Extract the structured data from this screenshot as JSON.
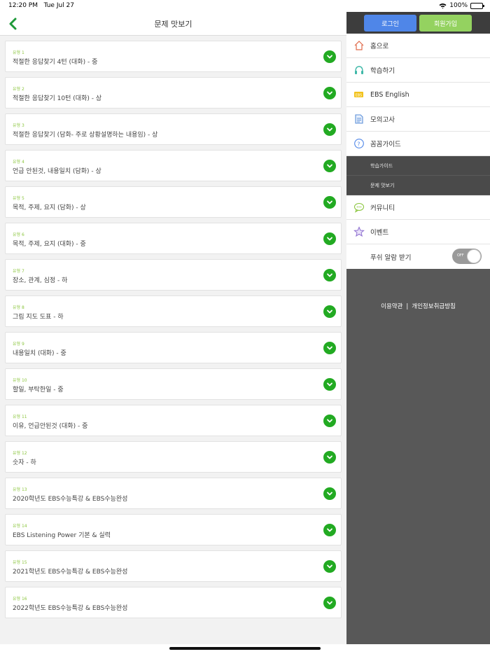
{
  "status_bar": {
    "time": "12:20 PM",
    "date": "Tue Jul 27",
    "battery": "100%"
  },
  "header": {
    "title": "문제 맛보기"
  },
  "items": [
    {
      "type": "유형 1",
      "title": "적절한 응답찾기 4턴 (대화) - 중"
    },
    {
      "type": "유형 2",
      "title": "적절한 응답찾기 10턴 (대화) - 상"
    },
    {
      "type": "유형 3",
      "title": "적절한 응답찾기 (담화- 주로 상황설명하는 내용임) - 상"
    },
    {
      "type": "유형 4",
      "title": "언급 안된것, 내용일치 (담화) - 상"
    },
    {
      "type": "유형 5",
      "title": "목적, 주제, 요지 (담화) - 상"
    },
    {
      "type": "유형 6",
      "title": "목적, 주제, 요지 (대화) - 중"
    },
    {
      "type": "유형 7",
      "title": "장소, 관계, 심정 - 하"
    },
    {
      "type": "유형 8",
      "title": "그림 지도 도표 - 하"
    },
    {
      "type": "유형 9",
      "title": "내용일치 (대화) - 중"
    },
    {
      "type": "유형 10",
      "title": "할일, 부탁한일 - 중"
    },
    {
      "type": "유형 11",
      "title": "이유, 언급안된것 (대화) - 중"
    },
    {
      "type": "유형 12",
      "title": "숫자 - 하"
    },
    {
      "type": "유형 13",
      "title": "2020학년도 EBS수능특강 & EBS수능완성"
    },
    {
      "type": "유형 14",
      "title": "EBS Listening Power 기본 & 실력"
    },
    {
      "type": "유형 15",
      "title": "2021학년도 EBS수능특강 & EBS수능완성"
    },
    {
      "type": "유형 16",
      "title": "2022학년도 EBS수능특강 & EBS수능완성"
    }
  ],
  "auth": {
    "login": "로그인",
    "signup": "회원가입"
  },
  "menu": [
    {
      "label": "홈으로",
      "icon": "home-icon"
    },
    {
      "label": "학습하기",
      "icon": "headphones-icon"
    },
    {
      "label": "EBS English",
      "icon": "ebs-english-icon"
    },
    {
      "label": "모의고사",
      "icon": "exam-icon"
    },
    {
      "label": "꼼꼼가이드",
      "icon": "question-icon"
    }
  ],
  "submenu": [
    {
      "label": "학습가이드"
    },
    {
      "label": "문제 맛보기"
    }
  ],
  "menu2": [
    {
      "label": "커뮤니티",
      "icon": "community-icon"
    },
    {
      "label": "이벤트",
      "icon": "star-icon"
    }
  ],
  "push": {
    "label": "푸쉬 알람 받기",
    "toggle_text": "OFF"
  },
  "footer": {
    "terms": "이용약관",
    "separator": "|",
    "privacy": "개인정보취급방침"
  },
  "colors": {
    "accent_green": "#22aa22",
    "type_green": "#8cc63f",
    "login_blue": "#4f86e8",
    "signup_green": "#94d260"
  }
}
